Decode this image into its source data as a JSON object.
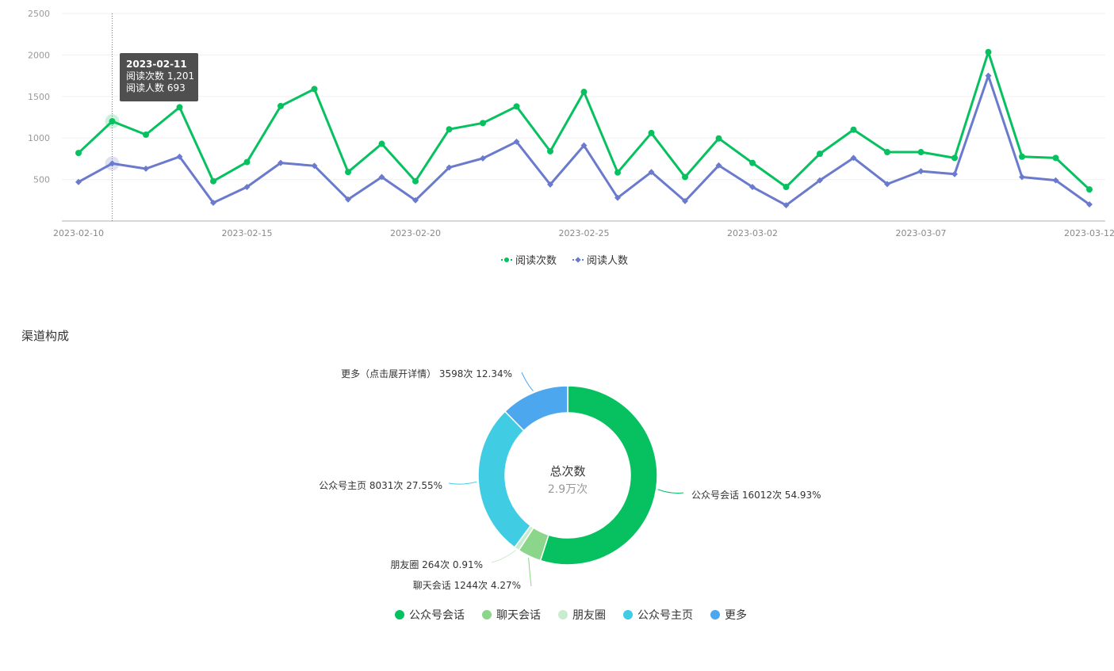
{
  "chart_data": [
    {
      "type": "line",
      "x": [
        "2023-02-10",
        "2023-02-11",
        "2023-02-12",
        "2023-02-13",
        "2023-02-14",
        "2023-02-15",
        "2023-02-16",
        "2023-02-17",
        "2023-02-18",
        "2023-02-19",
        "2023-02-20",
        "2023-02-21",
        "2023-02-22",
        "2023-02-23",
        "2023-02-24",
        "2023-02-25",
        "2023-02-26",
        "2023-02-27",
        "2023-02-28",
        "2023-03-01",
        "2023-03-02",
        "2023-03-03",
        "2023-03-04",
        "2023-03-05",
        "2023-03-06",
        "2023-03-07",
        "2023-03-08",
        "2023-03-09",
        "2023-03-10",
        "2023-03-11",
        "2023-03-12"
      ],
      "x_tick_labels": [
        "2023-02-10",
        "2023-02-15",
        "2023-02-20",
        "2023-02-25",
        "2023-03-02",
        "2023-03-07",
        "2023-03-12"
      ],
      "series": [
        {
          "name": "阅读次数",
          "color": "#07c160",
          "marker": "circle",
          "values": [
            820,
            1201,
            1040,
            1370,
            480,
            710,
            1385,
            1590,
            590,
            930,
            480,
            1105,
            1180,
            1380,
            840,
            1555,
            585,
            1060,
            530,
            995,
            700,
            410,
            810,
            1100,
            830,
            830,
            760,
            2035,
            775,
            760,
            380
          ]
        },
        {
          "name": "阅读人数",
          "color": "#6a7acc",
          "marker": "diamond",
          "values": [
            470,
            693,
            630,
            775,
            220,
            410,
            700,
            665,
            260,
            530,
            250,
            645,
            755,
            955,
            440,
            910,
            280,
            590,
            240,
            670,
            410,
            190,
            490,
            760,
            445,
            600,
            565,
            1750,
            530,
            490,
            200
          ]
        }
      ],
      "y_ticks": [
        500,
        1000,
        1500,
        2000,
        2500
      ],
      "ylim": [
        0,
        2500
      ],
      "grid": true,
      "legend_position": "bottom-center",
      "tooltip": {
        "date": "2023-02-11",
        "line1": "阅读次数 1,201",
        "line2": "阅读人数 693"
      },
      "highlight_x": "2023-02-11"
    },
    {
      "type": "pie",
      "title": "渠道构成",
      "center_label": "总次数",
      "center_value": "2.9万次",
      "slices": [
        {
          "name": "公众号会话",
          "value": 16012,
          "percent": 54.93,
          "color": "#07c160",
          "label": "公众号会话 16012次 54.93%"
        },
        {
          "name": "聊天会话",
          "value": 1244,
          "percent": 4.27,
          "color": "#8bd68b",
          "label": "聊天会话 1244次 4.27%"
        },
        {
          "name": "朋友圈",
          "value": 264,
          "percent": 0.91,
          "color": "#c9eccf",
          "label": "朋友圈 264次 0.91%"
        },
        {
          "name": "公众号主页",
          "value": 8031,
          "percent": 27.55,
          "color": "#40cde3",
          "label": "公众号主页 8031次 27.55%"
        },
        {
          "name": "更多",
          "value": 3598,
          "percent": 12.34,
          "color": "#4da7ee",
          "label": "更多（点击展开详情） 3598次 12.34%"
        }
      ],
      "legend_position": "bottom-center"
    }
  ]
}
